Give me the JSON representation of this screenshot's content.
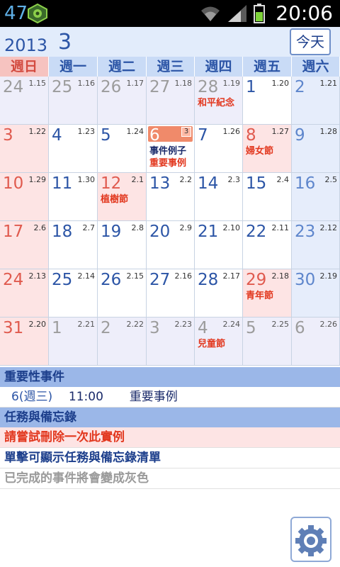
{
  "status_bar": {
    "left_number": "47",
    "time": "20:06",
    "icons": [
      "app-icon",
      "wifi-icon",
      "signal-icon",
      "battery-icon"
    ]
  },
  "header": {
    "year": "2013",
    "month": "3",
    "today_button": "今天"
  },
  "weekdays": [
    "週日",
    "週一",
    "週二",
    "週三",
    "週四",
    "週五",
    "週六"
  ],
  "calendar": {
    "weeks": [
      [
        {
          "day": "24",
          "lunar": "1.15",
          "type": "other"
        },
        {
          "day": "25",
          "lunar": "1.16",
          "type": "other"
        },
        {
          "day": "26",
          "lunar": "1.17",
          "type": "other"
        },
        {
          "day": "27",
          "lunar": "1.18",
          "type": "other"
        },
        {
          "day": "28",
          "lunar": "1.19",
          "type": "other",
          "notes": [
            "和平紀念"
          ]
        },
        {
          "day": "1",
          "lunar": "1.20",
          "type": "white"
        },
        {
          "day": "2",
          "lunar": "1.21",
          "type": "sat"
        }
      ],
      [
        {
          "day": "3",
          "lunar": "1.22",
          "type": "sun"
        },
        {
          "day": "4",
          "lunar": "1.23",
          "type": "white"
        },
        {
          "day": "5",
          "lunar": "1.24",
          "type": "white"
        },
        {
          "day": "6",
          "lunar": "",
          "type": "today",
          "count": "3",
          "notes": [
            "事件例子",
            "重要事例"
          ]
        },
        {
          "day": "7",
          "lunar": "1.26",
          "type": "white"
        },
        {
          "day": "8",
          "lunar": "1.27",
          "type": "holiday",
          "notes": [
            "婦女節"
          ]
        },
        {
          "day": "9",
          "lunar": "1.28",
          "type": "sat"
        }
      ],
      [
        {
          "day": "10",
          "lunar": "1.29",
          "type": "sun"
        },
        {
          "day": "11",
          "lunar": "1.30",
          "type": "white"
        },
        {
          "day": "12",
          "lunar": "2.1",
          "type": "holiday",
          "notes": [
            "植樹節"
          ]
        },
        {
          "day": "13",
          "lunar": "2.2",
          "type": "white"
        },
        {
          "day": "14",
          "lunar": "2.3",
          "type": "white"
        },
        {
          "day": "15",
          "lunar": "2.4",
          "type": "white"
        },
        {
          "day": "16",
          "lunar": "2.5",
          "type": "sat"
        }
      ],
      [
        {
          "day": "17",
          "lunar": "2.6",
          "type": "sun"
        },
        {
          "day": "18",
          "lunar": "2.7",
          "type": "white"
        },
        {
          "day": "19",
          "lunar": "2.8",
          "type": "white"
        },
        {
          "day": "20",
          "lunar": "2.9",
          "type": "white"
        },
        {
          "day": "21",
          "lunar": "2.10",
          "type": "white"
        },
        {
          "day": "22",
          "lunar": "2.11",
          "type": "white"
        },
        {
          "day": "23",
          "lunar": "2.12",
          "type": "sat"
        }
      ],
      [
        {
          "day": "24",
          "lunar": "2.13",
          "type": "sun"
        },
        {
          "day": "25",
          "lunar": "2.14",
          "type": "white"
        },
        {
          "day": "26",
          "lunar": "2.15",
          "type": "white"
        },
        {
          "day": "27",
          "lunar": "2.16",
          "type": "white"
        },
        {
          "day": "28",
          "lunar": "2.17",
          "type": "white"
        },
        {
          "day": "29",
          "lunar": "2.18",
          "type": "holiday",
          "notes": [
            "青年節"
          ]
        },
        {
          "day": "30",
          "lunar": "2.19",
          "type": "sat"
        }
      ],
      [
        {
          "day": "31",
          "lunar": "2.20",
          "type": "sun"
        },
        {
          "day": "1",
          "lunar": "2.21",
          "type": "other"
        },
        {
          "day": "2",
          "lunar": "2.22",
          "type": "other"
        },
        {
          "day": "3",
          "lunar": "2.23",
          "type": "other"
        },
        {
          "day": "4",
          "lunar": "2.24",
          "type": "other",
          "notes": [
            "兒童節"
          ]
        },
        {
          "day": "5",
          "lunar": "2.25",
          "type": "other"
        },
        {
          "day": "6",
          "lunar": "2.26",
          "type": "other"
        }
      ]
    ]
  },
  "important_events": {
    "title": "重要性事件",
    "items": [
      {
        "date": "6(週三)",
        "time": "11:00",
        "name": "重要事例"
      }
    ]
  },
  "tasks": {
    "title": "任務與備忘錄",
    "items": [
      {
        "text": "請嘗試刪除一次此實例",
        "style": "alert"
      },
      {
        "text": "單擊可顯示任務與備忘錄清單",
        "style": "navy"
      },
      {
        "text": "已完成的事件將會變成灰色",
        "style": "gray"
      }
    ]
  },
  "colors": {
    "accent_blue": "#2c55a6",
    "holiday_red": "#e2381f",
    "today_highlight": "#f08a6a",
    "header_bg": "#e2ecfb",
    "section_bg": "#9bb7e8"
  },
  "fab_icon": "gear-icon"
}
